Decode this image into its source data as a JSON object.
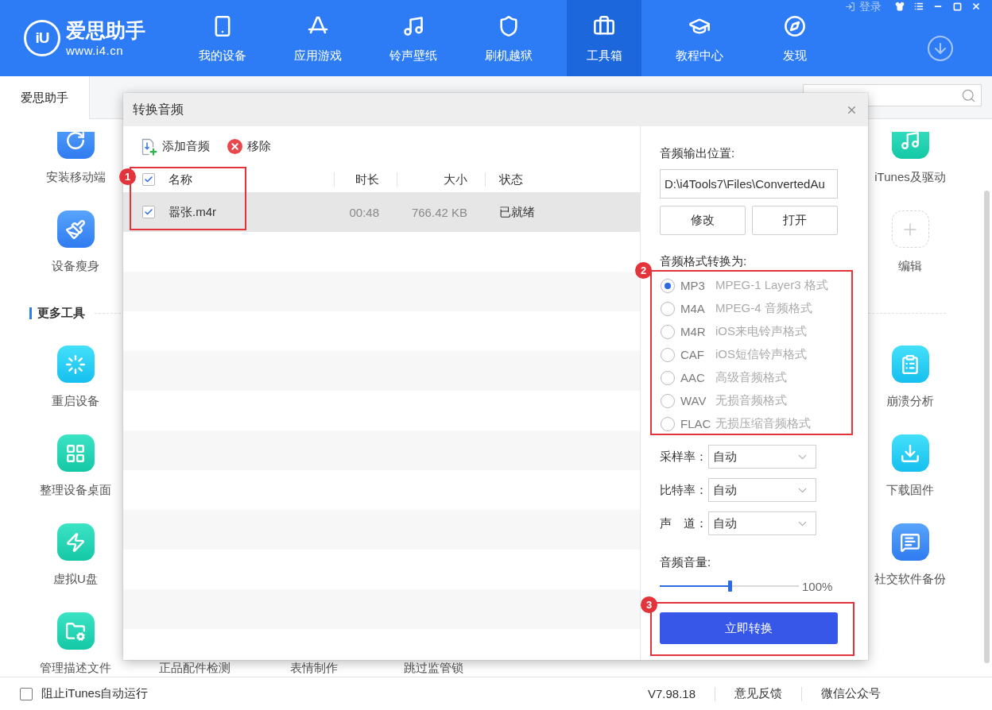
{
  "app_bar": {
    "brand": {
      "mark": "iU",
      "name": "爱思助手",
      "url": "www.i4.cn"
    },
    "nav": [
      {
        "kind": "phone",
        "label": "我的设备",
        "selected": false
      },
      {
        "kind": "apps",
        "label": "应用游戏",
        "selected": false
      },
      {
        "kind": "music",
        "label": "铃声壁纸",
        "selected": false
      },
      {
        "kind": "shield",
        "label": "刷机越狱",
        "selected": false
      },
      {
        "kind": "toolbox",
        "label": "工具箱",
        "selected": true
      },
      {
        "kind": "cap",
        "label": "教程中心",
        "selected": false
      },
      {
        "kind": "compass",
        "label": "发现",
        "selected": false
      }
    ],
    "login": "登录"
  },
  "tab_strip": {
    "tabs": [
      {
        "label": "爱思助手",
        "selected": true
      }
    ]
  },
  "my_tools": {
    "left": [
      {
        "kind": "install",
        "label": "安装移动端"
      },
      {
        "kind": "clean",
        "label": "设备瘦身"
      }
    ],
    "right": [
      {
        "kind": "itunes",
        "label": "iTunes及驱动"
      },
      {
        "kind": "add",
        "label": "编辑"
      }
    ]
  },
  "more_tools": {
    "title": "更多工具",
    "left": [
      {
        "kind": "restart",
        "label": "重启设备"
      },
      {
        "kind": "desktop",
        "label": "整理设备桌面"
      },
      {
        "kind": "udisk",
        "label": "虚拟U盘"
      },
      {
        "kind": "profile",
        "label": "管理描述文件"
      }
    ],
    "right": [
      {
        "kind": "crash",
        "label": "崩溃分析"
      },
      {
        "kind": "firmware",
        "label": "下载固件"
      },
      {
        "kind": "social",
        "label": "社交软件备份"
      }
    ],
    "bottom_labels": [
      "正品配件检测",
      "表情制作",
      "跳过监管锁"
    ]
  },
  "dialog": {
    "title": "转换音频",
    "toolbar": [
      {
        "kind": "add",
        "label": "添加音频"
      },
      {
        "kind": "remove",
        "label": "移除"
      }
    ],
    "table": {
      "annotation": "1",
      "all_checked": true,
      "columns": [
        "名称",
        "时长",
        "大小",
        "状态"
      ],
      "rows": [
        {
          "checked": true,
          "selected": true,
          "cells": [
            "嚣张.m4r",
            "00:48",
            "766.42 KB",
            "已就绪"
          ]
        }
      ]
    },
    "output": {
      "label": "音频输出位置:",
      "path": "D:\\i4Tools7\\Files\\ConvertedAu",
      "buttons": [
        "修改",
        "打开"
      ]
    },
    "format": {
      "label": "音频格式转换为:",
      "annotation": "2",
      "options": [
        {
          "format": "MP3",
          "description": "MPEG-1 Layer3 格式",
          "selected": true
        },
        {
          "format": "M4A",
          "description": "MPEG-4 音频格式",
          "selected": false
        },
        {
          "format": "M4R",
          "description": "iOS来电铃声格式",
          "selected": false
        },
        {
          "format": "CAF",
          "description": "iOS短信铃声格式",
          "selected": false
        },
        {
          "format": "AAC",
          "description": "高级音频格式",
          "selected": false
        },
        {
          "format": "WAV",
          "description": "无损音频格式",
          "selected": false
        },
        {
          "format": "FLAC",
          "description": "无损压缩音频格式",
          "selected": false
        }
      ]
    },
    "settings": [
      {
        "label": "采样率：",
        "value": "自动"
      },
      {
        "label": "比特率：",
        "value": "自动"
      },
      {
        "label": "声　道：",
        "value": "自动"
      }
    ],
    "volume": {
      "label": "音频音量:",
      "level": 0.5,
      "reading": "100%"
    },
    "convert": {
      "label": "立即转换",
      "annotation": "3"
    }
  },
  "status_bar": {
    "itunes_block": {
      "label": "阻止iTunes自动运行",
      "checked": false
    },
    "version": "V7.98.18",
    "links": [
      "意见反馈",
      "微信公众号"
    ]
  }
}
